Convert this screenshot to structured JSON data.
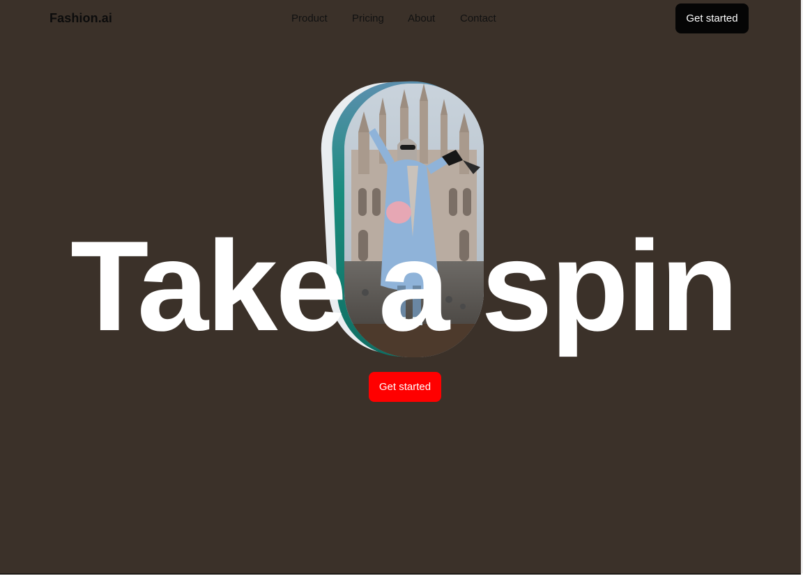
{
  "brand": {
    "logo": "Fashion.ai"
  },
  "nav": {
    "items": [
      {
        "label": "Product"
      },
      {
        "label": "Pricing"
      },
      {
        "label": "About"
      },
      {
        "label": "Contact"
      }
    ]
  },
  "header": {
    "cta_label": "Get started"
  },
  "hero": {
    "headline": "Take a spin",
    "cta_label": "Get started",
    "image_icon": "fashion-photo"
  },
  "colors": {
    "background": "#3b3129",
    "hero_cta": "#ff0000",
    "header_cta": "#050505",
    "headline": "#ffffff"
  }
}
